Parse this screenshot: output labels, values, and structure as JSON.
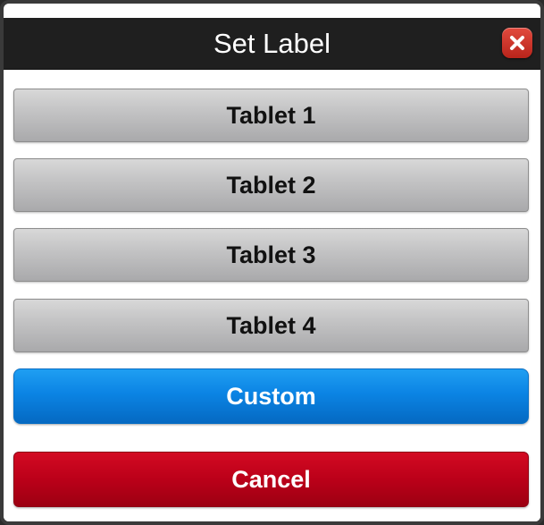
{
  "dialog": {
    "title": "Set Label",
    "close_icon": "close-icon",
    "options": [
      {
        "label": "Tablet 1"
      },
      {
        "label": "Tablet 2"
      },
      {
        "label": "Tablet 3"
      },
      {
        "label": "Tablet 4"
      }
    ],
    "custom_label": "Custom",
    "cancel_label": "Cancel"
  },
  "colors": {
    "titlebar": "#1f1f1f",
    "close_button": "#c9302c",
    "custom_button": "#0b84e4",
    "cancel_button": "#bb0019",
    "option_button": "#c4c4c5"
  }
}
